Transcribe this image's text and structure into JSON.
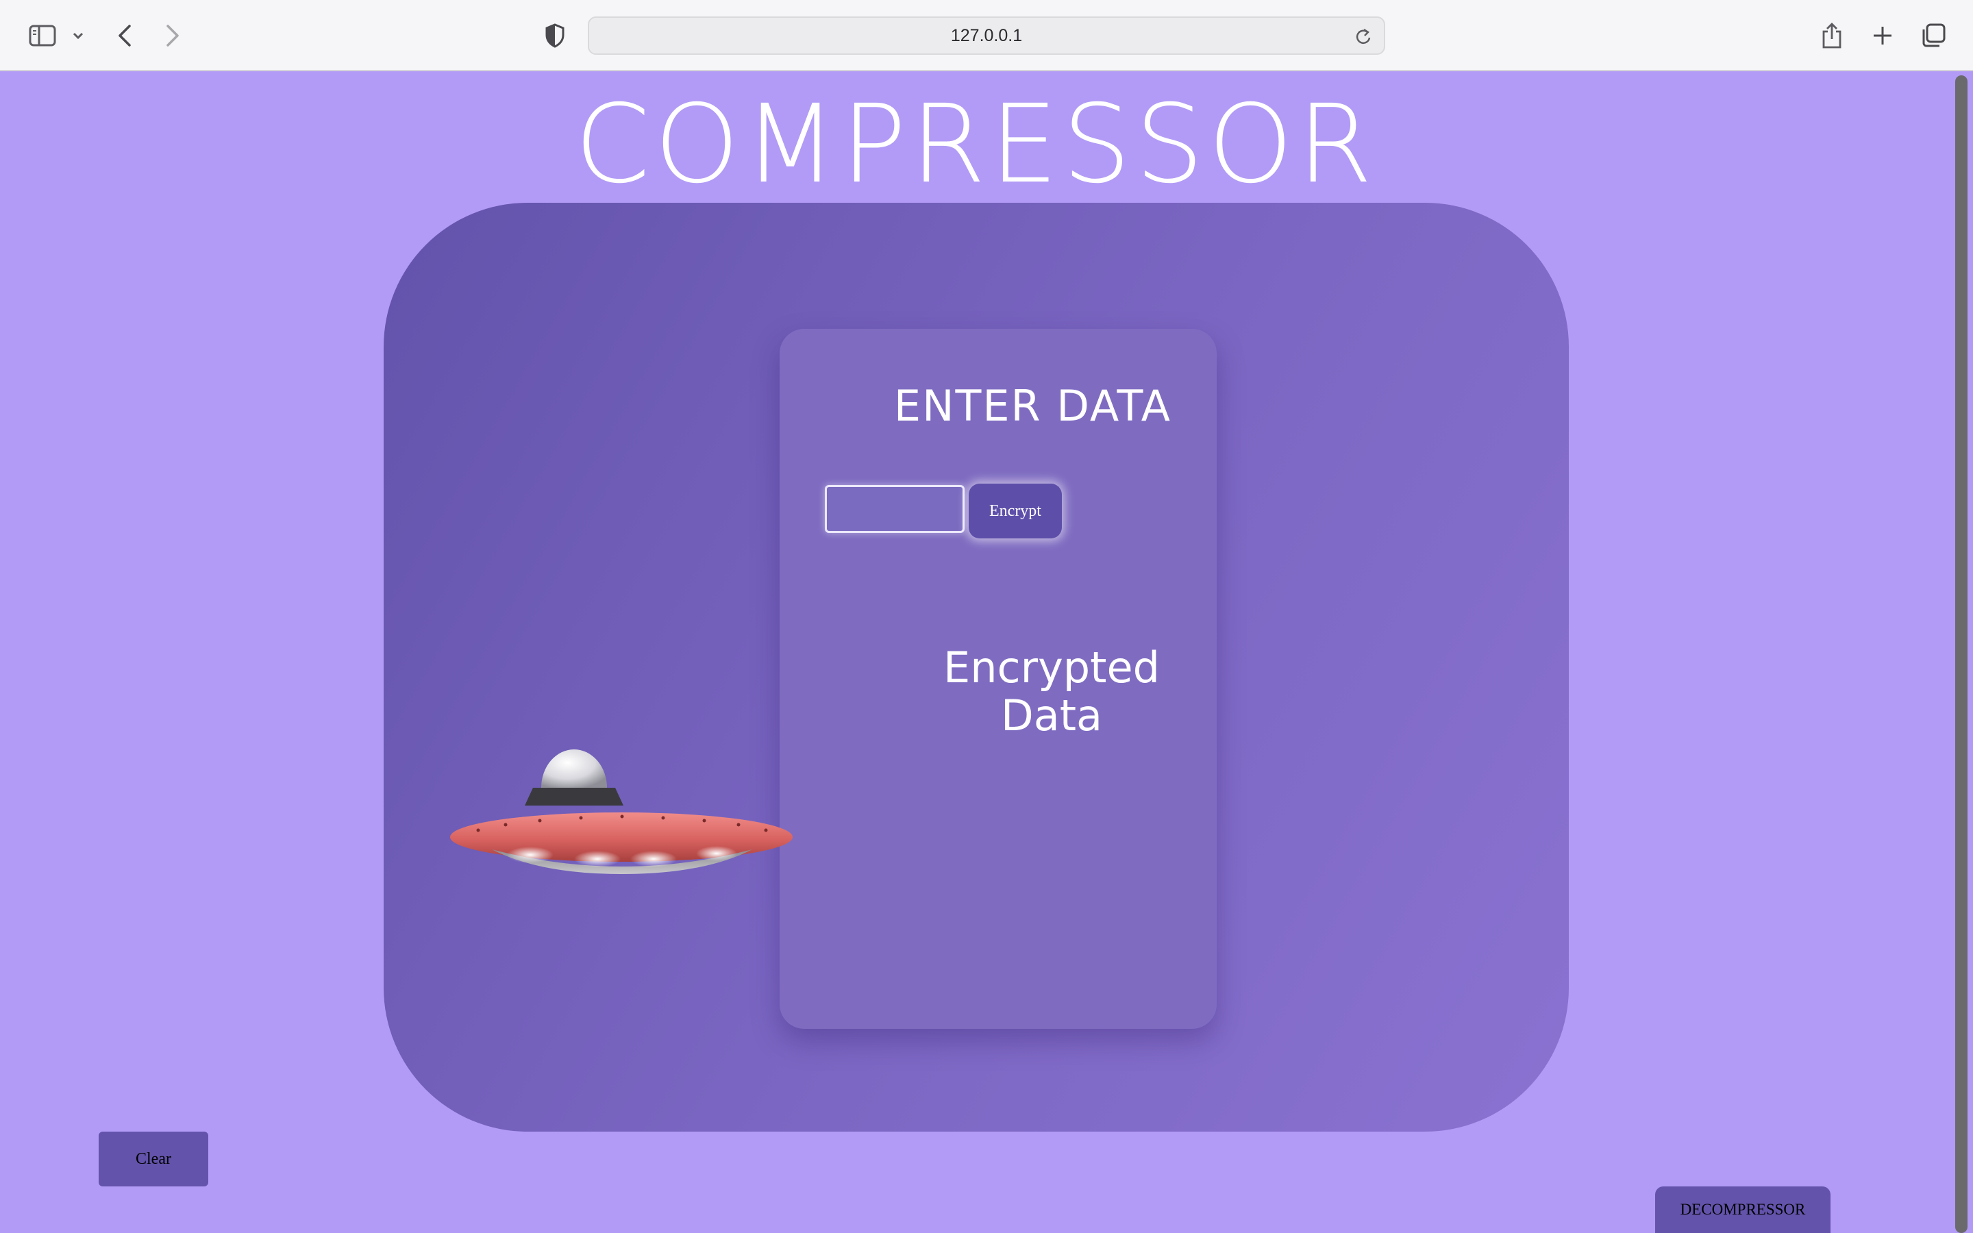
{
  "browser": {
    "url": "127.0.0.1",
    "icons": [
      "sidebar-icon",
      "chevron-down-icon",
      "back-icon",
      "forward-icon",
      "privacy-shield-icon",
      "reload-icon",
      "share-icon",
      "new-tab-icon",
      "tab-overview-icon"
    ]
  },
  "page": {
    "title": "COMPRESSOR",
    "card_heading": "ENTER DATA",
    "input_value": "",
    "encrypt_label": "Encrypt",
    "result_label_line1": "Encrypted",
    "result_label_line2": "Data",
    "clear_label": "Clear",
    "decompressor_label": "DECOMPRESSOR",
    "illustration": "ufo-illustration"
  },
  "colors": {
    "background": "#b29bf6",
    "stage_start": "#6353ab",
    "stage_end": "#8a72d1",
    "card": "#7f6cc1",
    "button": "#6353ab"
  }
}
